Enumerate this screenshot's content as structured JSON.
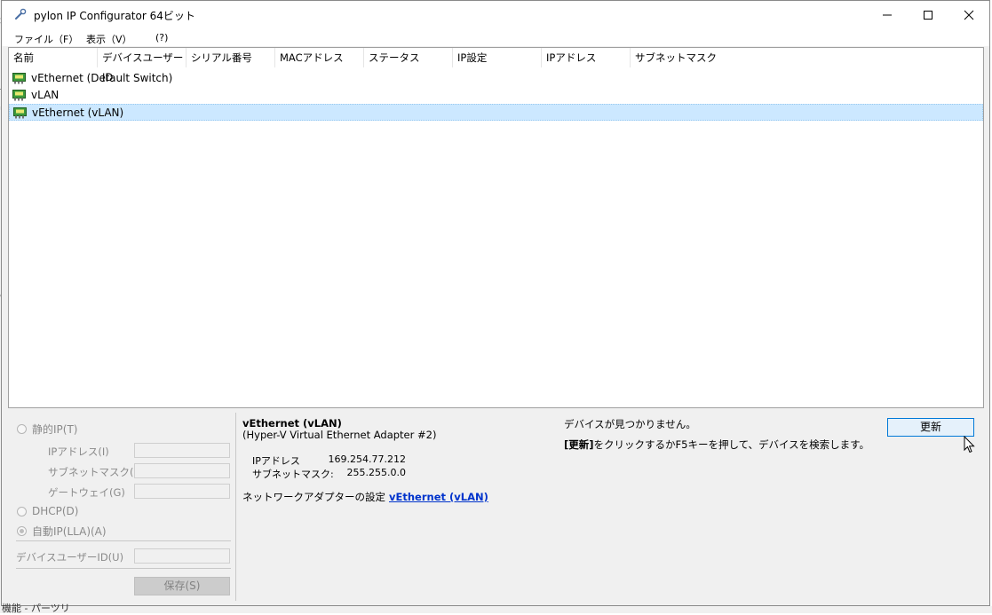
{
  "window": {
    "title": "pylon IP Configurator 64ビット",
    "app_icon": "wrench-icon"
  },
  "menu": [
    {
      "label": "ファイル（F）"
    },
    {
      "label": "表示（V）"
    },
    {
      "label": "(?)"
    }
  ],
  "list": {
    "columns": [
      "名前",
      "デバイスユーザーID",
      "シリアル番号",
      "MACアドレス",
      "ステータス",
      "IP設定",
      "IPアドレス",
      "サブネットマスク"
    ],
    "rows": [
      {
        "name": "vEthernet (Default Switch)",
        "icon": "network-adapter-icon",
        "selected": false
      },
      {
        "name": "vLAN",
        "icon": "network-adapter-icon",
        "selected": false
      },
      {
        "name": "vEthernet (vLAN)",
        "icon": "network-adapter-icon",
        "selected": true
      }
    ]
  },
  "ip_settings": {
    "static_ip": "静的IP(T)",
    "ip_address_label": "IPアドレス(I)",
    "subnet_mask_label": "サブネットマスク(M)",
    "gateway_label": "ゲートウェイ(G)",
    "dhcp": "DHCP(D)",
    "auto_ip": "自動IP(LLA)(A)",
    "selected_mode": "auto_ip",
    "device_user_id_label": "デバイスユーザーID(U)",
    "save_label": "保存(S)"
  },
  "details": {
    "device_name": "vEthernet (vLAN)",
    "device_desc": "(Hyper-V Virtual Ethernet Adapter #2)",
    "ip_label": "IPアドレス",
    "ip_value": "169.254.77.212",
    "mask_label": "サブネットマスク:",
    "mask_value": "255.255.0.0",
    "adapter_settings_label": "ネットワークアダプターの設定",
    "adapter_link": "vEthernet (vLAN)"
  },
  "status": {
    "not_found": "デバイスが見つかりません。",
    "hint_bold": "[更新]",
    "hint_rest": "をクリックするかF5キーを押して、デバイスを検索します。",
    "refresh_label": "更新"
  },
  "background": {
    "left_fragments": [
      "示",
      "ti",
      "ul",
      "e"
    ],
    "bottom_fragment": "機能 - パーツリ"
  },
  "colors": {
    "selection": "#cce8ff",
    "link": "#0033cc",
    "focus_border": "#0078d7"
  }
}
